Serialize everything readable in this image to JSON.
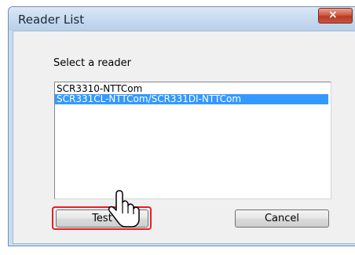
{
  "window": {
    "title": "Reader List",
    "close_label": "×"
  },
  "dialog": {
    "prompt": "Select a reader",
    "readers": [
      {
        "label": "SCR3310-NTTCom",
        "selected": false
      },
      {
        "label": "SCR331CL-NTTCom/SCR331DI-NTTCom",
        "selected": true
      }
    ],
    "test_label": "Test",
    "cancel_label": "Cancel"
  },
  "colors": {
    "selection": "#3399ff",
    "highlight": "#e21f26",
    "close_button": "#c9553d"
  },
  "icons": {
    "pointer": "hand-pointer-icon",
    "close": "close-icon"
  }
}
